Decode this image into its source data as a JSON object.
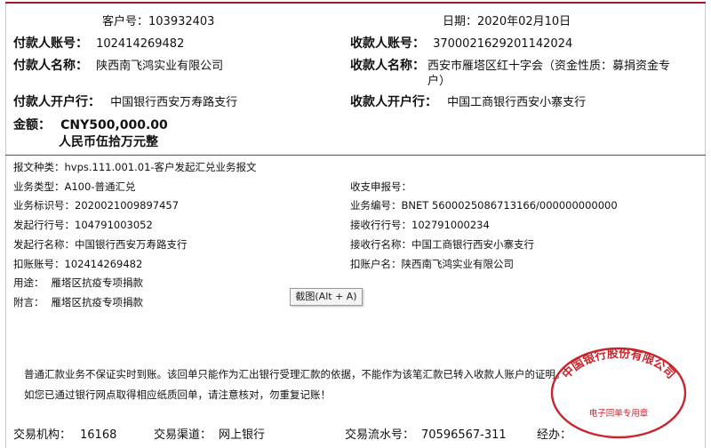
{
  "header": {
    "customer_no_label": "客户号：",
    "customer_no": "103932403",
    "date_label": "日期：",
    "date": "2020年02月10日"
  },
  "payer": {
    "account_label": "付款人账号：",
    "account": "102414269482",
    "name_label": "付款人名称：",
    "name": "陕西南飞鸿实业有限公司",
    "bank_label": "付款人开户行：",
    "bank": "中国银行西安万寿路支行"
  },
  "payee": {
    "account_label": "收款人账号：",
    "account": "370002162920114202 4",
    "name_label": "收款人名称：",
    "name_line1": "西安市雁塔区红十字会（资金性质：募捐资金专",
    "name_line2": "户）",
    "bank_label": "收款人开户行：",
    "bank": "中国工商银行西安小寨支行"
  },
  "amount": {
    "label": "金额：",
    "value": "CNY500,000.00",
    "words": "人民币伍拾万元整"
  },
  "details": {
    "msg_type_label": "报文种类：",
    "msg_type": "hvps.111.001.01-客户发起汇兑业务报文",
    "biz_type_label": "业务类型：",
    "biz_type": "A100-普通汇兑",
    "biz_id_label": "业务标识号：",
    "biz_id": "2020021009897457",
    "send_bank_no_label": "发起行行号：",
    "send_bank_no": "104791003052",
    "send_bank_name_label": "发起行名称：",
    "send_bank_name": "中国银行西安万寿路支行",
    "debit_account_label": "扣账账号：",
    "debit_account": "102414269482",
    "purpose_label": "用途：",
    "purpose": "雁塔区抗疫专项捐款",
    "postscript_label": "附言：",
    "postscript": "雁塔区抗疫专项捐款",
    "recv_apply_no_label": "收支申报号：",
    "recv_apply_no": "",
    "biz_no_label": "业务编号：",
    "biz_no": "BNET 5600025086713166/000000000000",
    "recv_bank_no_label": "接收行行号：",
    "recv_bank_no": "102791000234",
    "recv_bank_name_label": "接收行名称：",
    "recv_bank_name": "中国工商银行西安小寨支行",
    "debit_name_label": "扣账户名：",
    "debit_name": "陕西南飞鸿实业有限公司"
  },
  "tooltip": "截图(Alt + A)",
  "notice": {
    "line1": "普通汇款业务不保证实时到账。该回单只能作为汇出银行受理汇款的依据，不能作为该笔汇款已转入收款人账户的证明。",
    "line2": "如您已通过银行网点取得相应纸质回单，请注意核对，勿重复记账！"
  },
  "footer": {
    "org_label": "交易机构：",
    "org": "16168",
    "channel_label": "交易渠道：",
    "channel": "网上银行",
    "serial_label": "交易流水号：",
    "serial": "70596567-311",
    "handler_label": "经办："
  },
  "stamp": {
    "top_text": "中国银行股份有限公司",
    "bottom_text": "电子回单专用章",
    "color": "#c8252d"
  }
}
